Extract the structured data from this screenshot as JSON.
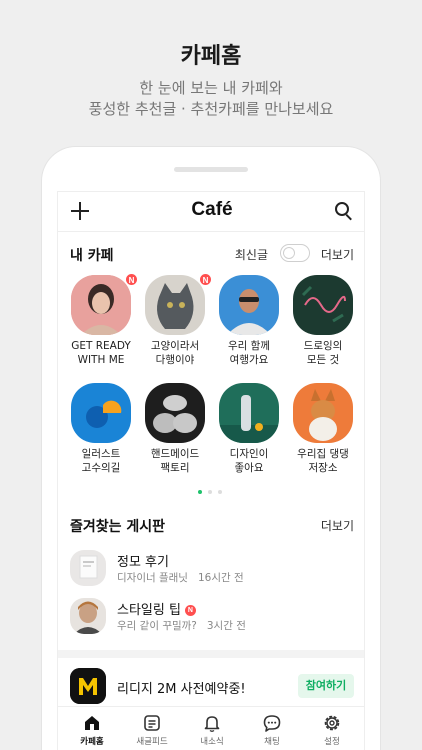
{
  "promo": {
    "title": "카페홈",
    "subtitle_line1": "한 눈에 보는 내 카페와",
    "subtitle_line2": "풍성한 추천글 · 추천카페를 만나보세요"
  },
  "appbar": {
    "logo": "Café",
    "icons": [
      "plus-icon",
      "search-icon"
    ]
  },
  "my_cafe": {
    "title": "내 카페",
    "recent_label": "최신글",
    "recent_toggle_on": false,
    "more_label": "더보기",
    "cafes": [
      {
        "line1": "GET READY",
        "line2": "WITH ME",
        "badge": "N"
      },
      {
        "line1": "고양이라서",
        "line2": "다행이야",
        "badge": "N"
      },
      {
        "line1": "우리 함께",
        "line2": "여행가요",
        "badge": ""
      },
      {
        "line1": "드로잉의",
        "line2": "모든 것",
        "badge": ""
      },
      {
        "line1": "일러스트",
        "line2": "고수의길",
        "badge": ""
      },
      {
        "line1": "핸드메이드",
        "line2": "팩토리",
        "badge": ""
      },
      {
        "line1": "디자인이",
        "line2": "좋아요",
        "badge": ""
      },
      {
        "line1": "우리집 댕댕",
        "line2": "저장소",
        "badge": ""
      }
    ],
    "page_dots": {
      "total": 3,
      "active": 1
    }
  },
  "favorites": {
    "title": "즐겨찾는 게시판",
    "more_label": "더보기",
    "items": [
      {
        "title": "정모 후기",
        "subtitle": "디자이너 플래닛",
        "time": "16시간 전",
        "badge": ""
      },
      {
        "title": "스타일링 팁",
        "subtitle": "우리 같이 꾸밀까?",
        "time": "3시간 전",
        "badge": "N"
      }
    ]
  },
  "ad": {
    "logo_letter": "M",
    "text": "리디지 2M 사전예약중!",
    "button": "참여하기"
  },
  "tabs": [
    {
      "label": "카페홈",
      "icon": "home-icon",
      "active": true
    },
    {
      "label": "새글피드",
      "icon": "feed-icon",
      "active": false
    },
    {
      "label": "내소식",
      "icon": "bell-icon",
      "active": false
    },
    {
      "label": "채팅",
      "icon": "chat-icon",
      "active": false
    },
    {
      "label": "설정",
      "icon": "gear-icon",
      "active": false
    }
  ],
  "colors": {
    "accent_green": "#0fae62",
    "badge_red": "#ff4f4f",
    "active_dot": "#1ec26b"
  }
}
